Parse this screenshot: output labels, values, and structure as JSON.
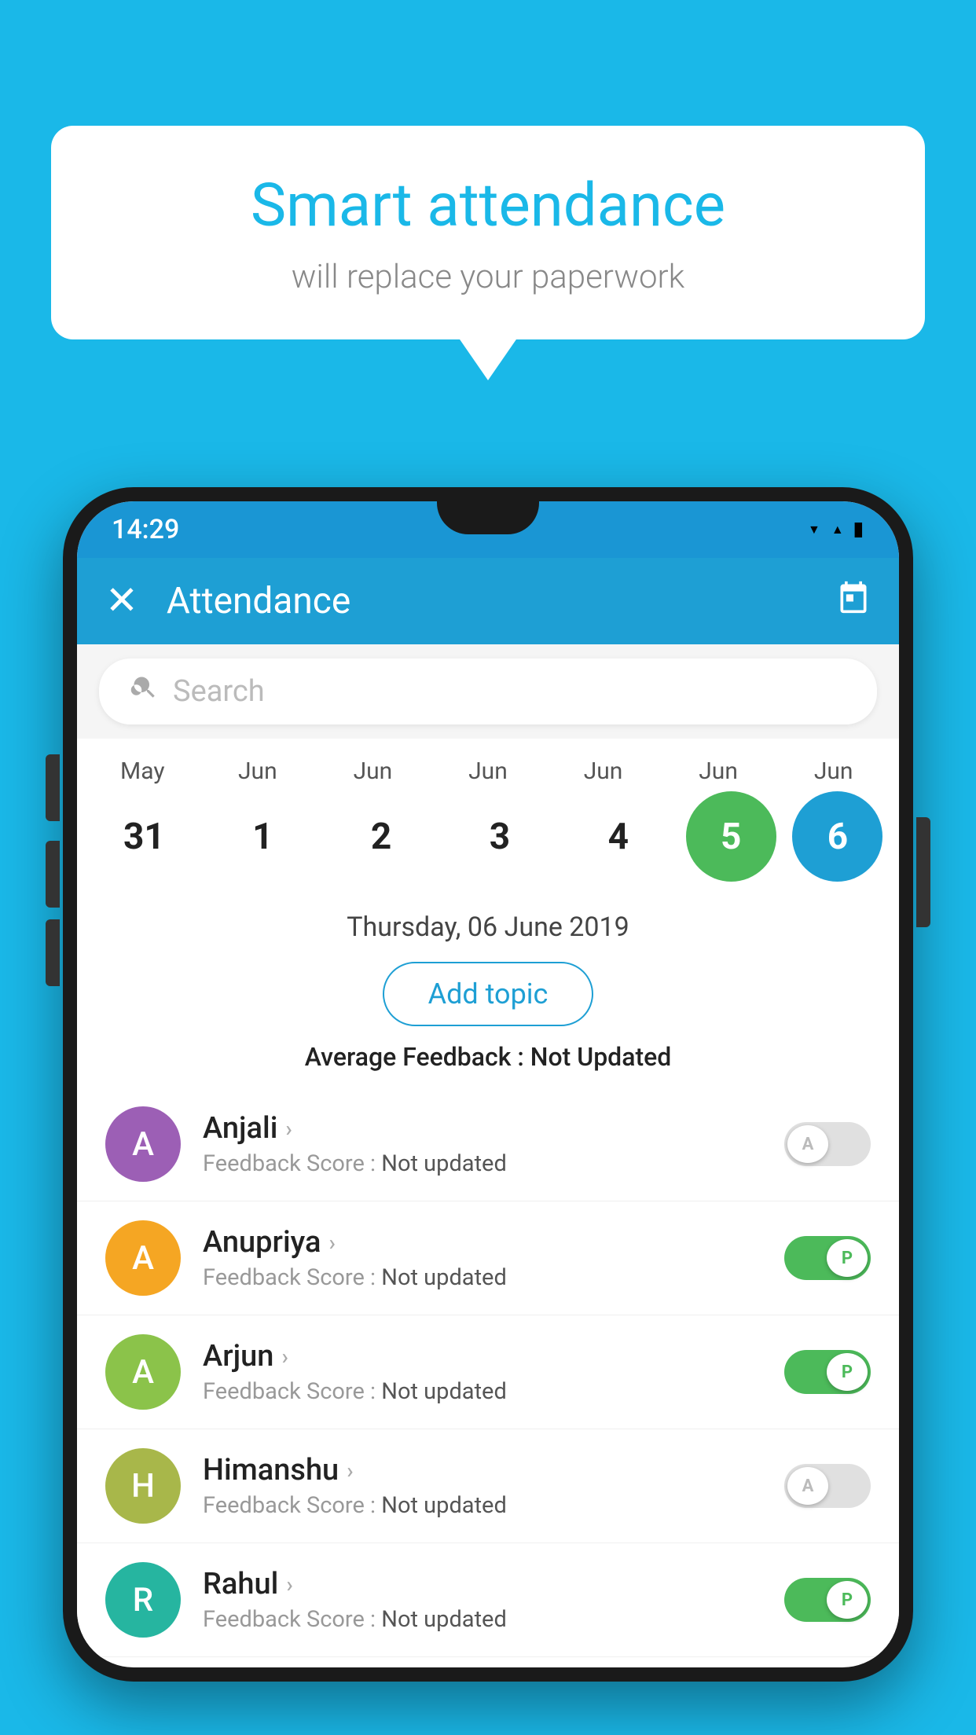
{
  "background_color": "#1ab8e8",
  "bubble": {
    "title": "Smart attendance",
    "subtitle": "will replace your paperwork"
  },
  "status_bar": {
    "time": "14:29",
    "icons": [
      "wifi",
      "signal",
      "battery"
    ]
  },
  "toolbar": {
    "title": "Attendance",
    "close_label": "×",
    "calendar_icon": "📅"
  },
  "search": {
    "placeholder": "Search"
  },
  "calendar": {
    "months": [
      "May",
      "Jun",
      "Jun",
      "Jun",
      "Jun",
      "Jun",
      "Jun"
    ],
    "dates": [
      "31",
      "1",
      "2",
      "3",
      "4",
      "5",
      "6"
    ],
    "selected_index": 5,
    "today_index": 6
  },
  "selected_date_label": "Thursday, 06 June 2019",
  "add_topic_label": "Add topic",
  "avg_feedback_prefix": "Average Feedback : ",
  "avg_feedback_value": "Not Updated",
  "students": [
    {
      "name": "Anjali",
      "avatar_letter": "A",
      "avatar_color": "av-purple",
      "feedback_prefix": "Feedback Score : ",
      "feedback_value": "Not updated",
      "attendance": "absent",
      "toggle_letter": "A"
    },
    {
      "name": "Anupriya",
      "avatar_letter": "A",
      "avatar_color": "av-orange",
      "feedback_prefix": "Feedback Score : ",
      "feedback_value": "Not updated",
      "attendance": "present",
      "toggle_letter": "P"
    },
    {
      "name": "Arjun",
      "avatar_letter": "A",
      "avatar_color": "av-green",
      "feedback_prefix": "Feedback Score : ",
      "feedback_value": "Not updated",
      "attendance": "present",
      "toggle_letter": "P"
    },
    {
      "name": "Himanshu",
      "avatar_letter": "H",
      "avatar_color": "av-olive",
      "feedback_prefix": "Feedback Score : ",
      "feedback_value": "Not updated",
      "attendance": "absent",
      "toggle_letter": "A"
    },
    {
      "name": "Rahul",
      "avatar_letter": "R",
      "avatar_color": "av-teal",
      "feedback_prefix": "Feedback Score : ",
      "feedback_value": "Not updated",
      "attendance": "present",
      "toggle_letter": "P"
    }
  ]
}
